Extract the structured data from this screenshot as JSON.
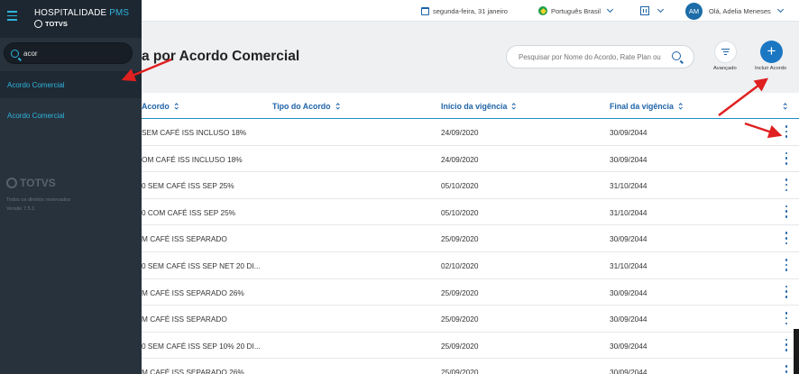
{
  "sidebar": {
    "brand": {
      "name": "HOSPITALIDADE",
      "suffix": "PMS",
      "company": "TOTVS"
    },
    "search": {
      "value": "acor"
    },
    "items": [
      {
        "label": "Acordo Comercial"
      },
      {
        "label": "Acordo Comercial"
      }
    ],
    "footer": {
      "logo_text": "TOTVS",
      "rights": "Todos os direitos reservados",
      "version": "Versão 7.5.1"
    }
  },
  "topbar": {
    "date": "segunda-feira, 31 janeiro",
    "language": "Português Brasil",
    "user_initials": "AM",
    "greeting": "Olá, Adelia Meneses"
  },
  "header": {
    "title": "a por Acordo Comercial",
    "search_placeholder": "Pesquisar por Nome do Acordo, Rate Plan ou",
    "advanced_label": "Avançado",
    "add_label": "Incluir Acordo"
  },
  "table": {
    "columns": [
      "Acordo",
      "Tipo do Acordo",
      "Início da vigência",
      "Final da vigência"
    ],
    "rows": [
      {
        "name": "SEM CAFÉ ISS INCLUSO 18%",
        "type": "",
        "start": "24/09/2020",
        "end": "30/09/2044"
      },
      {
        "name": "OM CAFÉ ISS INCLUSO 18%",
        "type": "",
        "start": "24/09/2020",
        "end": "30/09/2044"
      },
      {
        "name": "0 SEM CAFÉ ISS SEP 25%",
        "type": "",
        "start": "05/10/2020",
        "end": "31/10/2044"
      },
      {
        "name": "0 COM CAFÉ ISS SEP 25%",
        "type": "",
        "start": "05/10/2020",
        "end": "31/10/2044"
      },
      {
        "name": "M CAFÉ ISS SEPARADO",
        "type": "",
        "start": "25/09/2020",
        "end": "30/09/2044"
      },
      {
        "name": "0 SEM CAFÉ ISS SEP NET 20 DI...",
        "type": "",
        "start": "02/10/2020",
        "end": "31/10/2044"
      },
      {
        "name": "M CAFÉ ISS SEPARADO 26%",
        "type": "",
        "start": "25/09/2020",
        "end": "30/09/2044"
      },
      {
        "name": "M CAFÉ ISS SEPARADO",
        "type": "",
        "start": "25/09/2020",
        "end": "30/09/2044"
      },
      {
        "name": "0 SEM CAFÉ ISS SEP 10% 20 DI...",
        "type": "",
        "start": "25/09/2020",
        "end": "30/09/2044"
      },
      {
        "name": "M CAFÉ ISS SEPARADO 26%",
        "type": "",
        "start": "25/09/2020",
        "end": "30/09/2044"
      }
    ]
  },
  "colors": {
    "accent": "#1e63a8",
    "sidebar_bg": "#27323d",
    "sidebar_link": "#2fb4dd",
    "annotation_arrow": "#e02020"
  }
}
